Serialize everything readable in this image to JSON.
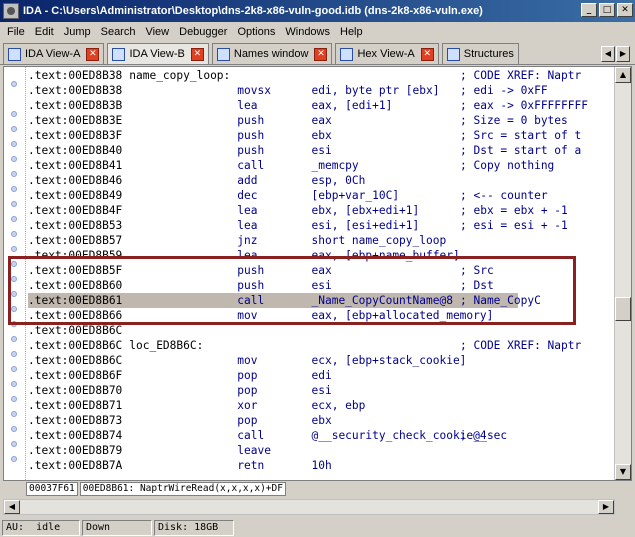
{
  "window": {
    "title": "IDA - C:\\Users\\Administrator\\Desktop\\dns-2k8-x86-vuln-good.idb (dns-2k8-x86-vuln.exe)",
    "minimize": "_",
    "maximize": "□",
    "close": "✕"
  },
  "menu": [
    "File",
    "Edit",
    "Jump",
    "Search",
    "View",
    "Debugger",
    "Options",
    "Windows",
    "Help"
  ],
  "menu_mnemonics": [
    "F",
    "E",
    "J",
    "S",
    "V",
    "D",
    "O",
    "W",
    "H"
  ],
  "tabs": [
    {
      "label": "IDA View-A",
      "icon": "ida-view-icon",
      "active": false
    },
    {
      "label": "IDA View-B",
      "icon": "ida-view-icon",
      "active": true
    },
    {
      "label": "Names window",
      "icon": "names-icon",
      "active": false
    },
    {
      "label": "Hex View-A",
      "icon": "hex-view-icon",
      "active": false
    },
    {
      "label": "Structures",
      "icon": "structures-icon",
      "active": false
    }
  ],
  "code": [
    {
      "addr": ".text:00ED8B38",
      "label": "name_copy_loop:",
      "mn": "",
      "op": "",
      "cmt": "; CODE XREF: Naptr"
    },
    {
      "addr": ".text:00ED8B38",
      "label": "",
      "mn": "movsx",
      "op": "edi, byte ptr [ebx]",
      "cmt": "; edi -> 0xFF"
    },
    {
      "addr": ".text:00ED8B3B",
      "label": "",
      "mn": "lea",
      "op": "eax, [edi+1]",
      "cmt": "; eax -> 0xFFFFFFFF"
    },
    {
      "addr": ".text:00ED8B3E",
      "label": "",
      "mn": "push",
      "op": "eax",
      "cmt": "; Size = 0 bytes"
    },
    {
      "addr": ".text:00ED8B3F",
      "label": "",
      "mn": "push",
      "op": "ebx",
      "cmt": "; Src = start of t"
    },
    {
      "addr": ".text:00ED8B40",
      "label": "",
      "mn": "push",
      "op": "esi",
      "cmt": "; Dst = start of a"
    },
    {
      "addr": ".text:00ED8B41",
      "label": "",
      "mn": "call",
      "op": "_memcpy",
      "cmt": "; Copy nothing"
    },
    {
      "addr": ".text:00ED8B46",
      "label": "",
      "mn": "add",
      "op": "esp, 0Ch",
      "cmt": ""
    },
    {
      "addr": ".text:00ED8B49",
      "label": "",
      "mn": "dec",
      "op": "[ebp+var_10C]",
      "cmt": "; <-- counter"
    },
    {
      "addr": ".text:00ED8B4F",
      "label": "",
      "mn": "lea",
      "op": "ebx, [ebx+edi+1]",
      "cmt": "; ebx = ebx + -1"
    },
    {
      "addr": ".text:00ED8B53",
      "label": "",
      "mn": "lea",
      "op": "esi, [esi+edi+1]",
      "cmt": "; esi = esi + -1"
    },
    {
      "addr": ".text:00ED8B57",
      "label": "",
      "mn": "jnz",
      "op": "short name_copy_loop",
      "cmt": ""
    },
    {
      "addr": ".text:00ED8B59",
      "label": "",
      "mn": "lea",
      "op": "eax, [ebp+name_buffer]",
      "cmt": ""
    },
    {
      "addr": ".text:00ED8B5F",
      "label": "",
      "mn": "push",
      "op": "eax",
      "cmt": "; Src"
    },
    {
      "addr": ".text:00ED8B60",
      "label": "",
      "mn": "push",
      "op": "esi",
      "cmt": "; Dst"
    },
    {
      "addr": ".text:00ED8B61",
      "label": "",
      "mn": "call",
      "op": "_Name_CopyCountName@8",
      "cmt": "; Name_CopyC"
    },
    {
      "addr": ".text:00ED8B66",
      "label": "",
      "mn": "mov",
      "op": "eax, [ebp+allocated_memory]",
      "cmt": ""
    },
    {
      "addr": ".text:00ED8B6C",
      "label": "",
      "mn": "",
      "op": "",
      "cmt": ""
    },
    {
      "addr": ".text:00ED8B6C",
      "label": "loc_ED8B6C:",
      "mn": "",
      "op": "",
      "cmt": "; CODE XREF: Naptr"
    },
    {
      "addr": ".text:00ED8B6C",
      "label": "",
      "mn": "mov",
      "op": "ecx, [ebp+stack_cookie]",
      "cmt": ""
    },
    {
      "addr": ".text:00ED8B6F",
      "label": "",
      "mn": "pop",
      "op": "edi",
      "cmt": ""
    },
    {
      "addr": ".text:00ED8B70",
      "label": "",
      "mn": "pop",
      "op": "esi",
      "cmt": ""
    },
    {
      "addr": ".text:00ED8B71",
      "label": "",
      "mn": "xor",
      "op": "ecx, ebp",
      "cmt": ""
    },
    {
      "addr": ".text:00ED8B73",
      "label": "",
      "mn": "pop",
      "op": "ebx",
      "cmt": ""
    },
    {
      "addr": ".text:00ED8B74",
      "label": "",
      "mn": "call",
      "op": "@__security_check_cookie@4",
      "cmt": "; __sec"
    },
    {
      "addr": ".text:00ED8B79",
      "label": "",
      "mn": "leave",
      "op": "",
      "cmt": ""
    },
    {
      "addr": ".text:00ED8B7A",
      "label": "",
      "mn": "retn",
      "op": "10h",
      "cmt": ""
    }
  ],
  "status": {
    "offset": "00037F61",
    "location": "00ED8B61: NaptrWireRead(x,x,x,x)+DF"
  },
  "bottom": {
    "au": "AU:  idle",
    "mode": "Down",
    "disk": "Disk: 18GB"
  }
}
